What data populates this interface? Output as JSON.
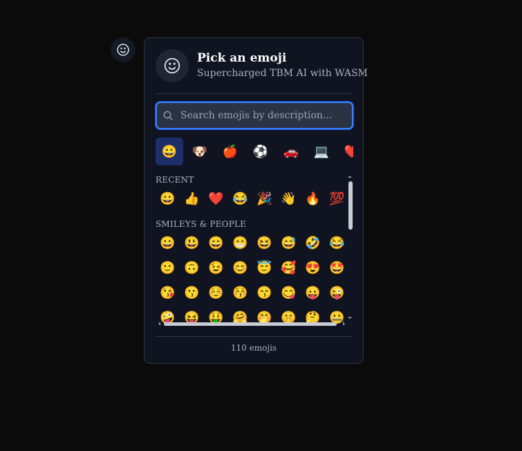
{
  "header": {
    "title": "Pick an emoji",
    "subtitle": "Supercharged TBM AI with WASM"
  },
  "search": {
    "placeholder": "Search emojis by description...",
    "value": ""
  },
  "categories": [
    {
      "name": "smileys",
      "glyph": "😀",
      "active": true
    },
    {
      "name": "animals",
      "glyph": "🐶",
      "active": false
    },
    {
      "name": "food",
      "glyph": "🍎",
      "active": false
    },
    {
      "name": "activities",
      "glyph": "⚽",
      "active": false
    },
    {
      "name": "travel",
      "glyph": "🚗",
      "active": false
    },
    {
      "name": "objects",
      "glyph": "💻",
      "active": false
    },
    {
      "name": "symbols",
      "glyph": "❤️",
      "active": false
    }
  ],
  "sections": {
    "recent_label": "RECENT",
    "smileys_label": "SMILEYS & PEOPLE"
  },
  "recent": [
    "😀",
    "👍",
    "❤️",
    "😂",
    "🎉",
    "👋",
    "🔥",
    "💯"
  ],
  "smileys": [
    "😀",
    "😃",
    "😄",
    "😁",
    "😆",
    "😅",
    "🤣",
    "😂",
    "🙂",
    "🙃",
    "😉",
    "😊",
    "😇",
    "🥰",
    "😍",
    "🤩",
    "😘",
    "😗",
    "☺️",
    "😚",
    "😙",
    "😋",
    "😛",
    "😜",
    "🤪",
    "😝",
    "🤑",
    "🤗",
    "🤭",
    "🤫",
    "🤔",
    "🤐"
  ],
  "footer": {
    "count_text": "110 emojis"
  },
  "colors": {
    "accent": "#3b82f6",
    "panel": "#0f1420",
    "active_category": "#1c2f6b"
  }
}
